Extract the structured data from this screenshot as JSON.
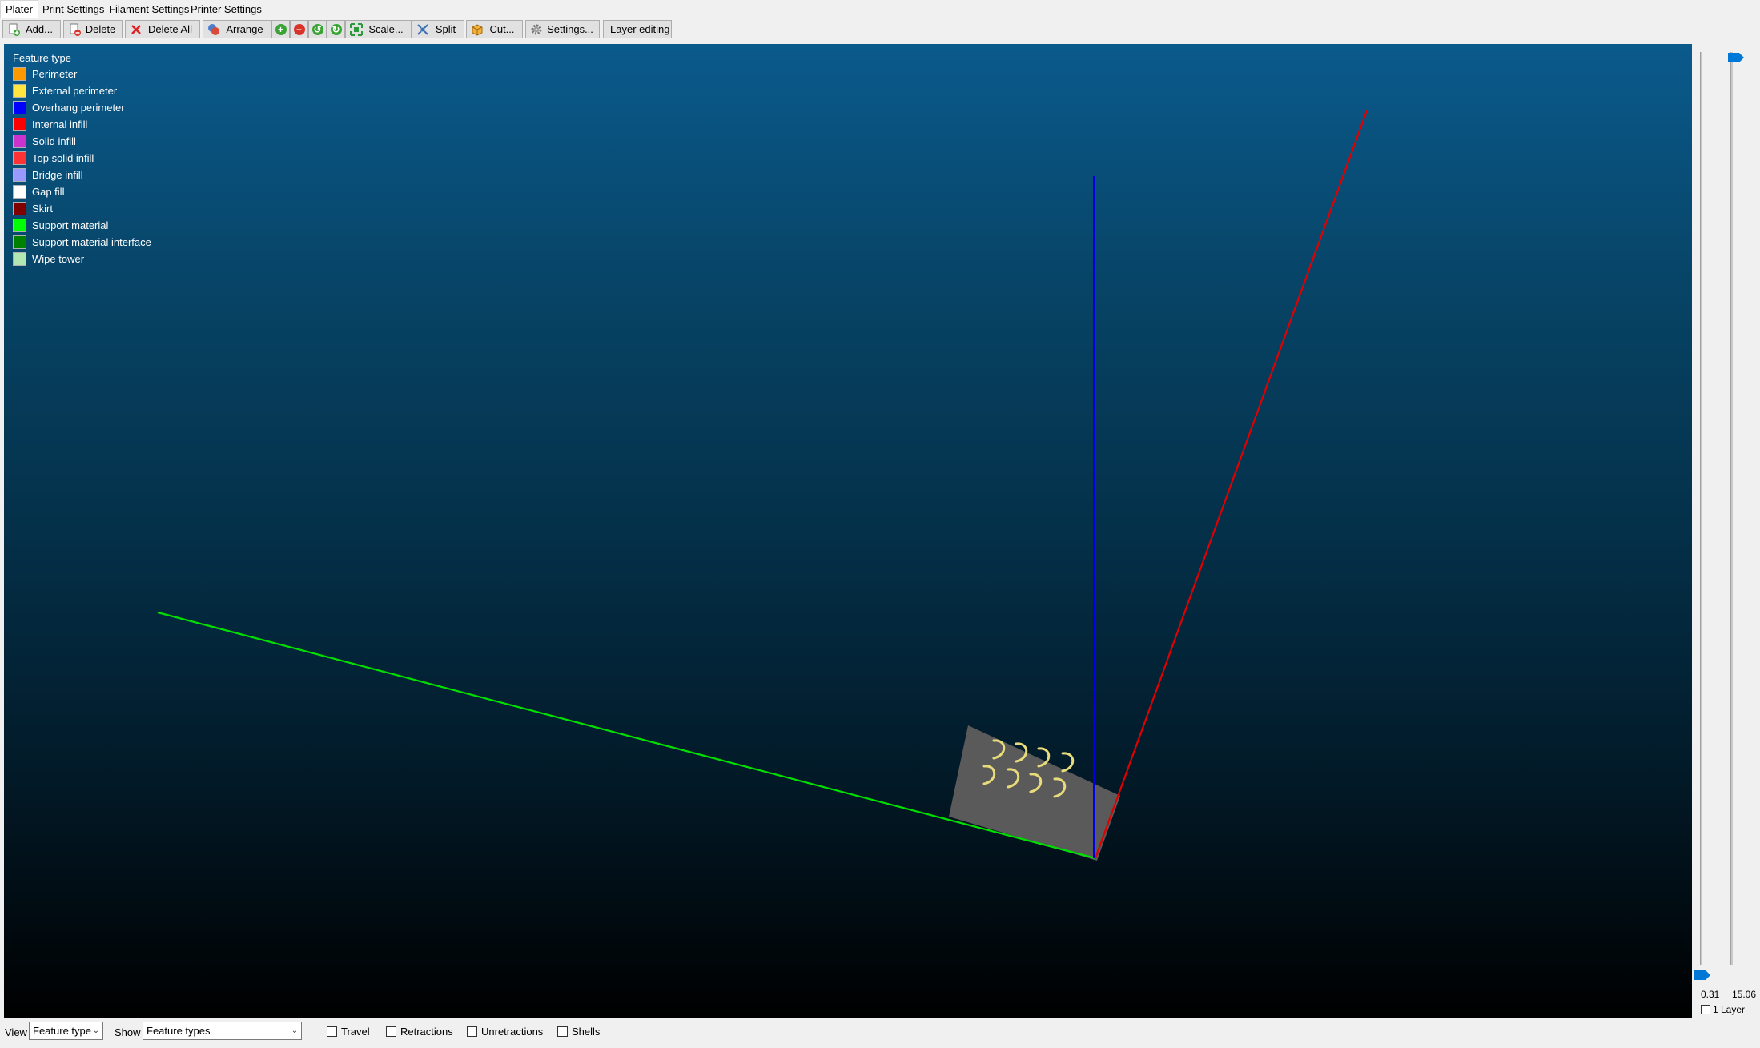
{
  "tabs": [
    {
      "label": "Plater",
      "active": true
    },
    {
      "label": "Print Settings",
      "active": false
    },
    {
      "label": "Filament Settings",
      "active": false
    },
    {
      "label": "Printer Settings",
      "active": false
    }
  ],
  "toolbar": {
    "add": "Add...",
    "delete": "Delete",
    "delete_all": "Delete All",
    "arrange": "Arrange",
    "scale": "Scale...",
    "split": "Split",
    "cut": "Cut...",
    "settings": "Settings...",
    "layer_editing": "Layer editing"
  },
  "legend": {
    "title": "Feature type",
    "items": [
      {
        "label": "Perimeter",
        "color": "#ff9900"
      },
      {
        "label": "External perimeter",
        "color": "#ffe640"
      },
      {
        "label": "Overhang perimeter",
        "color": "#0000ff"
      },
      {
        "label": "Internal infill",
        "color": "#ff0000"
      },
      {
        "label": "Solid infill",
        "color": "#cc33cc"
      },
      {
        "label": "Top solid infill",
        "color": "#ff3333"
      },
      {
        "label": "Bridge infill",
        "color": "#9999ff"
      },
      {
        "label": "Gap fill",
        "color": "#ffffff"
      },
      {
        "label": "Skirt",
        "color": "#800000"
      },
      {
        "label": "Support material",
        "color": "#00ff00"
      },
      {
        "label": "Support material interface",
        "color": "#008000"
      },
      {
        "label": "Wipe tower",
        "color": "#b3e6b3"
      }
    ]
  },
  "slider": {
    "min_value": "0.31",
    "max_value": "15.06",
    "one_layer_label": "1 Layer"
  },
  "bottom": {
    "view_label": "View",
    "view_value": "Feature type",
    "show_label": "Show",
    "show_value": "Feature types",
    "travel": "Travel",
    "retractions": "Retractions",
    "unretractions": "Unretractions",
    "shells": "Shells"
  },
  "colors": {
    "axis_x": "#e00000",
    "axis_y": "#00e000",
    "axis_z": "#0000e0",
    "bed": "#5a5a5a",
    "part": "#e8dc7a"
  }
}
